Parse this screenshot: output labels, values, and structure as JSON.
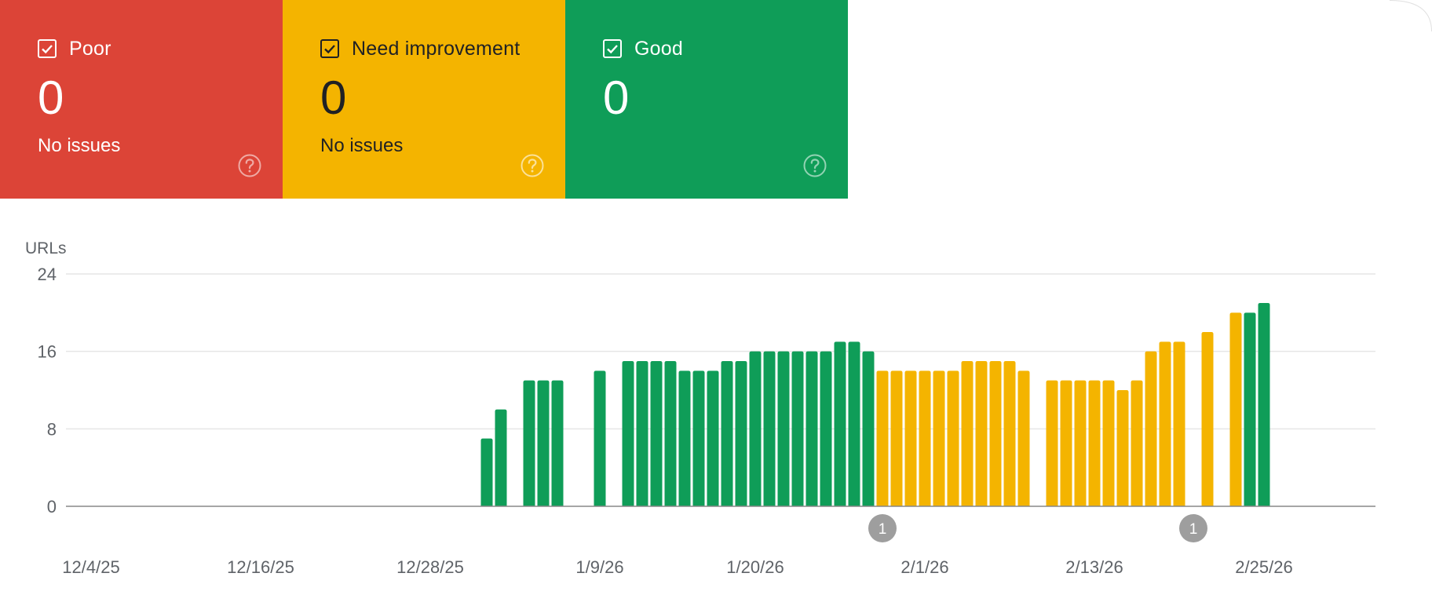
{
  "colors": {
    "poor": "#dc4437",
    "needs_improvement": "#f4b400",
    "good": "#0f9d58",
    "grid": "#e6e6e6",
    "baseline": "#888888",
    "annotation": "#9e9e9e",
    "axis_text": "#5f6368"
  },
  "status_cards": [
    {
      "id": "poor",
      "label": "Poor",
      "count": "0",
      "subtitle": "No issues",
      "checked": true,
      "checkbox_icon": "checkbox-checked-icon",
      "help_icon": "help-circle-icon"
    },
    {
      "id": "needs_improvement",
      "label": "Need improvement",
      "count": "0",
      "subtitle": "No issues",
      "checked": true,
      "checkbox_icon": "checkbox-checked-icon",
      "help_icon": "help-circle-icon"
    },
    {
      "id": "good",
      "label": "Good",
      "count": "0",
      "subtitle": "",
      "checked": true,
      "checkbox_icon": "checkbox-checked-icon",
      "help_icon": "help-circle-icon"
    }
  ],
  "chart_data": {
    "type": "bar",
    "ylabel": "URLs",
    "ylim": [
      0,
      24
    ],
    "yticks": [
      0,
      8,
      16,
      24
    ],
    "grid": true,
    "x_tick_labels": [
      "12/4/25",
      "12/16/25",
      "12/28/25",
      "1/9/26",
      "1/20/26",
      "2/1/26",
      "2/13/26",
      "2/25/26"
    ],
    "x_tick_days": [
      0,
      12,
      24,
      36,
      47,
      59,
      71,
      83
    ],
    "x_start": "12/4/25",
    "x_end": "3/4/26",
    "bars": [
      {
        "date": "1/1/26",
        "value": 7,
        "status": "good"
      },
      {
        "date": "1/2/26",
        "value": 10,
        "status": "good"
      },
      {
        "date": "1/4/26",
        "value": 13,
        "status": "good"
      },
      {
        "date": "1/5/26",
        "value": 13,
        "status": "good"
      },
      {
        "date": "1/6/26",
        "value": 13,
        "status": "good"
      },
      {
        "date": "1/9/26",
        "value": 14,
        "status": "good"
      },
      {
        "date": "1/11/26",
        "value": 15,
        "status": "good"
      },
      {
        "date": "1/12/26",
        "value": 15,
        "status": "good"
      },
      {
        "date": "1/13/26",
        "value": 15,
        "status": "good"
      },
      {
        "date": "1/14/26",
        "value": 15,
        "status": "good"
      },
      {
        "date": "1/15/26",
        "value": 14,
        "status": "good"
      },
      {
        "date": "1/16/26",
        "value": 14,
        "status": "good"
      },
      {
        "date": "1/17/26",
        "value": 14,
        "status": "good"
      },
      {
        "date": "1/18/26",
        "value": 15,
        "status": "good"
      },
      {
        "date": "1/19/26",
        "value": 15,
        "status": "good"
      },
      {
        "date": "1/20/26",
        "value": 16,
        "status": "good"
      },
      {
        "date": "1/21/26",
        "value": 16,
        "status": "good"
      },
      {
        "date": "1/22/26",
        "value": 16,
        "status": "good"
      },
      {
        "date": "1/23/26",
        "value": 16,
        "status": "good"
      },
      {
        "date": "1/24/26",
        "value": 16,
        "status": "good"
      },
      {
        "date": "1/25/26",
        "value": 16,
        "status": "good"
      },
      {
        "date": "1/26/26",
        "value": 17,
        "status": "good"
      },
      {
        "date": "1/27/26",
        "value": 17,
        "status": "good"
      },
      {
        "date": "1/28/26",
        "value": 16,
        "status": "good"
      },
      {
        "date": "1/29/26",
        "value": 14,
        "status": "needs_improvement"
      },
      {
        "date": "1/30/26",
        "value": 14,
        "status": "needs_improvement"
      },
      {
        "date": "1/31/26",
        "value": 14,
        "status": "needs_improvement"
      },
      {
        "date": "2/1/26",
        "value": 14,
        "status": "needs_improvement"
      },
      {
        "date": "2/2/26",
        "value": 14,
        "status": "needs_improvement"
      },
      {
        "date": "2/3/26",
        "value": 14,
        "status": "needs_improvement"
      },
      {
        "date": "2/4/26",
        "value": 15,
        "status": "needs_improvement"
      },
      {
        "date": "2/5/26",
        "value": 15,
        "status": "needs_improvement"
      },
      {
        "date": "2/6/26",
        "value": 15,
        "status": "needs_improvement"
      },
      {
        "date": "2/7/26",
        "value": 15,
        "status": "needs_improvement"
      },
      {
        "date": "2/8/26",
        "value": 14,
        "status": "needs_improvement"
      },
      {
        "date": "2/10/26",
        "value": 13,
        "status": "needs_improvement"
      },
      {
        "date": "2/11/26",
        "value": 13,
        "status": "needs_improvement"
      },
      {
        "date": "2/12/26",
        "value": 13,
        "status": "needs_improvement"
      },
      {
        "date": "2/13/26",
        "value": 13,
        "status": "needs_improvement"
      },
      {
        "date": "2/14/26",
        "value": 13,
        "status": "needs_improvement"
      },
      {
        "date": "2/15/26",
        "value": 12,
        "status": "needs_improvement"
      },
      {
        "date": "2/16/26",
        "value": 13,
        "status": "needs_improvement"
      },
      {
        "date": "2/17/26",
        "value": 16,
        "status": "needs_improvement"
      },
      {
        "date": "2/18/26",
        "value": 17,
        "status": "needs_improvement"
      },
      {
        "date": "2/19/26",
        "value": 17,
        "status": "needs_improvement"
      },
      {
        "date": "2/21/26",
        "value": 18,
        "status": "needs_improvement"
      },
      {
        "date": "2/23/26",
        "value": 20,
        "status": "needs_improvement"
      },
      {
        "date": "2/24/26",
        "value": 20,
        "status": "good"
      },
      {
        "date": "2/25/26",
        "value": 21,
        "status": "good"
      }
    ],
    "annotations": [
      {
        "date": "1/29/26",
        "label": "1"
      },
      {
        "date": "2/20/26",
        "label": "1"
      }
    ]
  }
}
